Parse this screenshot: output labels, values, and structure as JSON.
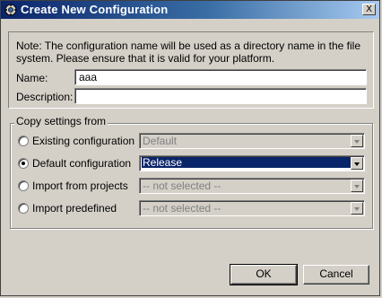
{
  "window": {
    "title": "Create New Configuration",
    "close_label": "X"
  },
  "note": "Note: The configuration name will be used as a directory name in the file system.  Please ensure that it is valid for your platform.",
  "fields": {
    "name_label": "Name:",
    "name_value": "aaa",
    "description_label": "Description:",
    "description_value": ""
  },
  "copy_settings": {
    "group_title": "Copy settings from",
    "options": [
      {
        "label": "Existing configuration",
        "selected": false,
        "combo_value": "Default",
        "enabled": false
      },
      {
        "label": "Default configuration",
        "selected": true,
        "combo_value": "Release",
        "enabled": true
      },
      {
        "label": "Import from projects",
        "selected": false,
        "combo_value": "-- not selected --",
        "enabled": false
      },
      {
        "label": "Import predefined",
        "selected": false,
        "combo_value": "-- not selected --",
        "enabled": false
      }
    ]
  },
  "buttons": {
    "ok": "OK",
    "cancel": "Cancel"
  },
  "colors": {
    "title_bar_start": "#0a246a",
    "title_bar_end": "#a6caf0",
    "selection": "#0a246a",
    "dialog_bg": "#d4d0c8"
  }
}
